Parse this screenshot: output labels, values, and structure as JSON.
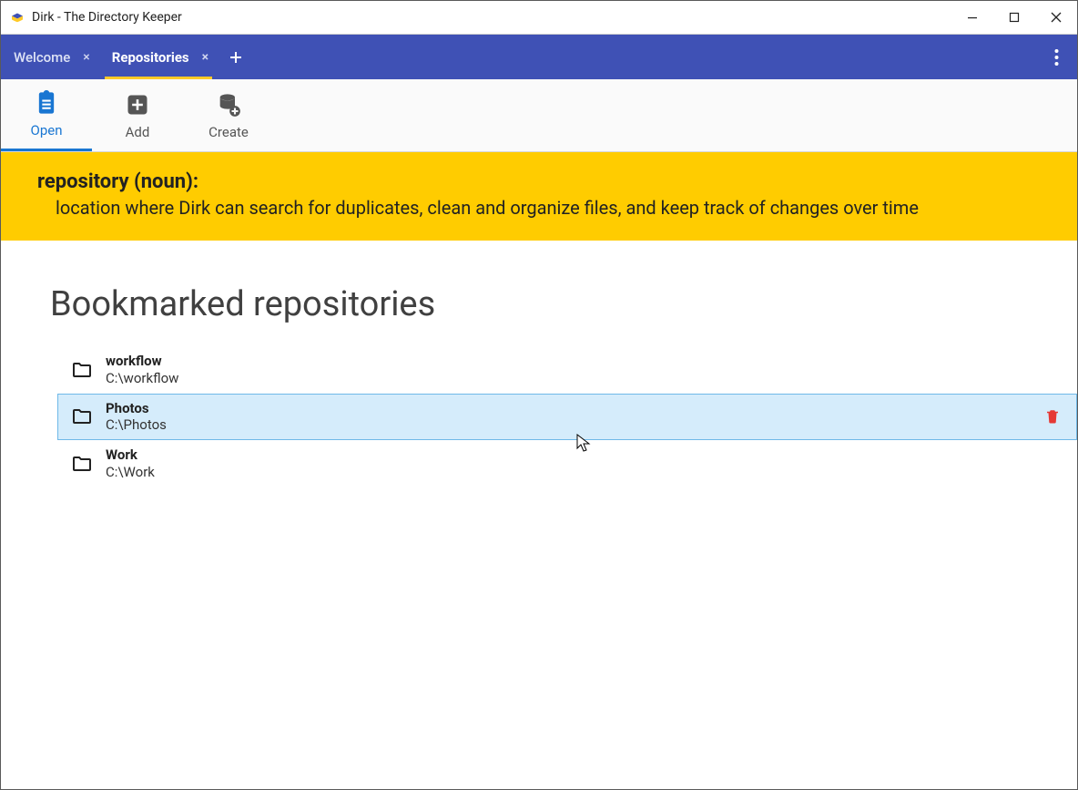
{
  "window": {
    "title": "Dirk - The Directory Keeper"
  },
  "tabs": [
    {
      "label": "Welcome",
      "active": false
    },
    {
      "label": "Repositories",
      "active": true
    }
  ],
  "toolbar": {
    "open": "Open",
    "add": "Add",
    "create": "Create"
  },
  "definition": {
    "term": "repository (noun):",
    "text": "location where Dirk can search for duplicates, clean and organize files, and keep track of changes over time"
  },
  "section_title": "Bookmarked repositories",
  "repos": [
    {
      "name": "workflow",
      "path": "C:\\workflow",
      "selected": false
    },
    {
      "name": "Photos",
      "path": "C:\\Photos",
      "selected": true
    },
    {
      "name": "Work",
      "path": "C:\\Work",
      "selected": false
    }
  ]
}
